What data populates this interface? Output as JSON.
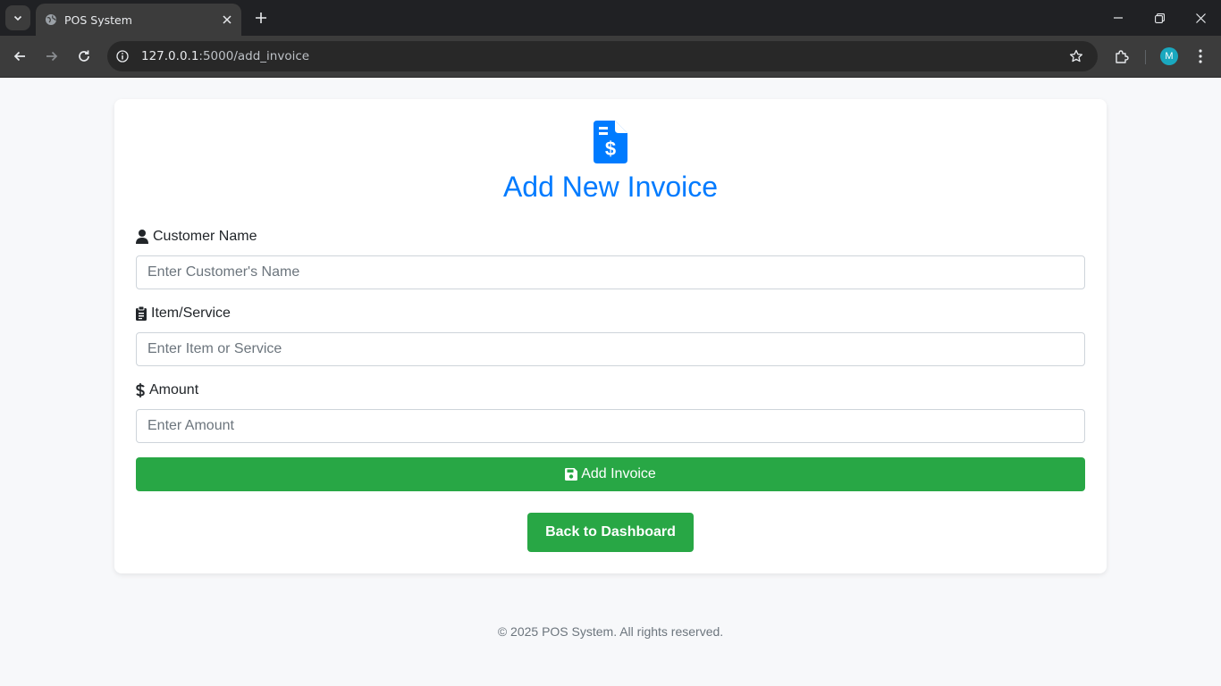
{
  "browser": {
    "tab_title": "POS System",
    "url_host": "127.0.0.1",
    "url_path": ":5000/add_invoice",
    "profile_initial": "M"
  },
  "page": {
    "title": "Add New Invoice",
    "fields": [
      {
        "label": "Customer Name",
        "placeholder": "Enter Customer's Name",
        "value": ""
      },
      {
        "label": "Item/Service",
        "placeholder": "Enter Item or Service",
        "value": ""
      },
      {
        "label": "Amount",
        "placeholder": "Enter Amount",
        "value": ""
      }
    ],
    "submit_label": "Add Invoice",
    "back_label": "Back to Dashboard"
  },
  "footer": {
    "text": "© 2025 POS System. All rights reserved."
  },
  "colors": {
    "primary": "#007bff",
    "success": "#28a745",
    "page_bg": "#f7f8fa"
  }
}
